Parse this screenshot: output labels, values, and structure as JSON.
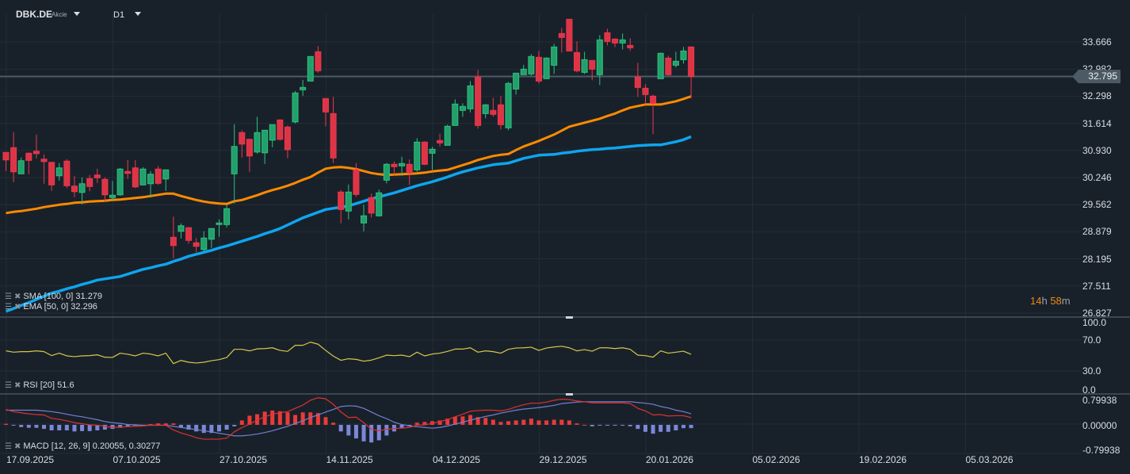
{
  "header": {
    "symbol": "DBK.DE",
    "type": "Akcie",
    "timeframe": "D1"
  },
  "legend": {
    "sma": "SMA [100,  0] 31.279",
    "ema": "EMA [50,  0] 32.296",
    "rsi": "RSI [20]  51.6",
    "macd": "MACD [12, 26, 9] 0.20055,  0.30277"
  },
  "price_axis": [
    "33.666",
    "32.982",
    "32.298",
    "31.614",
    "30.930",
    "30.246",
    "29.562",
    "28.879",
    "28.195",
    "27.511",
    "26.827"
  ],
  "current_price": "32.795",
  "rsi_axis": [
    "100.0",
    "70.0",
    "30.0",
    "0.0"
  ],
  "macd_axis": [
    "0.79938",
    "0.00000",
    "-0.79938"
  ],
  "date_axis": [
    "17.09.2025",
    "07.10.2025",
    "27.10.2025",
    "14.11.2025",
    "04.12.2025",
    "29.12.2025",
    "20.01.2026",
    "05.02.2026",
    "19.02.2026",
    "05.03.2026"
  ],
  "timer": {
    "hours": "14",
    "h": "h",
    "minutes": "58",
    "m": "m"
  },
  "colors": {
    "up": "#22a06b",
    "down": "#dc3545",
    "ema": "#ff8a00",
    "sma": "#0ea5ee",
    "rsi": "#d6c74a",
    "macd": "#e03131",
    "signal": "#7280cf",
    "hist_up": "#ea3a3a",
    "hist_down": "#7b87d9",
    "background": "#18212a"
  },
  "chart_data": {
    "type": "candlestick",
    "ohlc": [
      [
        30.88,
        30.88,
        30.41,
        30.69
      ],
      [
        31.0,
        31.39,
        30.13,
        30.39
      ],
      [
        30.34,
        30.75,
        30.33,
        30.67
      ],
      [
        30.86,
        30.88,
        30.33,
        30.68
      ],
      [
        30.91,
        31.33,
        30.73,
        30.85
      ],
      [
        30.71,
        30.83,
        30.09,
        30.65
      ],
      [
        30.63,
        30.63,
        29.91,
        30.06
      ],
      [
        30.29,
        30.61,
        30.17,
        30.49
      ],
      [
        30.66,
        30.71,
        29.98,
        30.04
      ],
      [
        30.03,
        30.29,
        29.75,
        29.89
      ],
      [
        29.87,
        30.25,
        29.57,
        30.09
      ],
      [
        30.22,
        30.31,
        29.9,
        30.02
      ],
      [
        30.31,
        30.47,
        30.11,
        30.24
      ],
      [
        30.2,
        30.25,
        29.64,
        29.81
      ],
      [
        29.74,
        30.16,
        29.66,
        29.8
      ],
      [
        29.81,
        30.49,
        29.79,
        30.46
      ],
      [
        30.4,
        30.69,
        30.21,
        30.35
      ],
      [
        30.49,
        30.69,
        29.98,
        30.01
      ],
      [
        30.06,
        30.51,
        30.05,
        30.46
      ],
      [
        30.09,
        30.41,
        29.74,
        30.33
      ],
      [
        30.46,
        30.54,
        30.06,
        30.1
      ],
      [
        30.21,
        30.44,
        29.91,
        30.44
      ],
      [
        28.74,
        29.26,
        28.21,
        28.53
      ],
      [
        28.89,
        29.09,
        28.71,
        29.03
      ],
      [
        28.98,
        29.0,
        28.58,
        28.66
      ],
      [
        28.6,
        28.72,
        28.36,
        28.51
      ],
      [
        28.43,
        28.89,
        28.39,
        28.72
      ],
      [
        28.69,
        28.96,
        28.47,
        28.96
      ],
      [
        29.06,
        29.19,
        28.75,
        29.1
      ],
      [
        29.06,
        29.56,
        28.99,
        29.46
      ],
      [
        30.34,
        31.59,
        29.59,
        31.03
      ],
      [
        31.38,
        31.44,
        30.75,
        31.09
      ],
      [
        31.21,
        31.23,
        30.39,
        30.79
      ],
      [
        30.89,
        31.78,
        30.85,
        31.38
      ],
      [
        30.87,
        31.44,
        30.59,
        31.44
      ],
      [
        31.19,
        31.58,
        31.01,
        31.58
      ],
      [
        31.7,
        31.7,
        31.18,
        31.21
      ],
      [
        31.52,
        31.56,
        30.73,
        30.95
      ],
      [
        31.65,
        32.43,
        31.61,
        32.38
      ],
      [
        32.46,
        32.71,
        32.31,
        32.52
      ],
      [
        32.68,
        33.3,
        32.68,
        33.3
      ],
      [
        33.42,
        33.56,
        32.89,
        32.94
      ],
      [
        32.24,
        32.24,
        31.54,
        31.9
      ],
      [
        31.86,
        32.28,
        30.61,
        30.74
      ],
      [
        29.88,
        29.93,
        29.09,
        29.44
      ],
      [
        29.4,
        30.07,
        29.19,
        29.88
      ],
      [
        30.44,
        30.61,
        29.76,
        29.82
      ],
      [
        29.1,
        29.56,
        28.89,
        29.28
      ],
      [
        29.74,
        29.84,
        29.24,
        29.35
      ],
      [
        29.28,
        29.94,
        29.26,
        29.86
      ],
      [
        30.18,
        30.61,
        30.1,
        30.58
      ],
      [
        30.58,
        30.65,
        30.29,
        30.52
      ],
      [
        30.54,
        30.77,
        30.29,
        30.6
      ],
      [
        30.58,
        30.7,
        30.06,
        30.36
      ],
      [
        30.44,
        31.24,
        30.39,
        31.14
      ],
      [
        31.14,
        31.16,
        30.56,
        30.58
      ],
      [
        30.86,
        31.02,
        30.44,
        30.96
      ],
      [
        31.18,
        31.35,
        31.03,
        31.12
      ],
      [
        31.06,
        31.58,
        31.06,
        31.54
      ],
      [
        31.56,
        32.22,
        31.56,
        32.1
      ],
      [
        31.94,
        32.12,
        31.78,
        32.04
      ],
      [
        31.98,
        32.68,
        31.89,
        32.56
      ],
      [
        32.78,
        32.96,
        31.48,
        31.56
      ],
      [
        31.86,
        32.1,
        31.74,
        32.08
      ],
      [
        31.94,
        32.26,
        31.78,
        31.84
      ],
      [
        32.08,
        32.3,
        31.46,
        31.58
      ],
      [
        31.5,
        32.66,
        31.44,
        32.62
      ],
      [
        32.48,
        32.88,
        32.34,
        32.88
      ],
      [
        32.84,
        33.09,
        32.84,
        32.98
      ],
      [
        32.86,
        33.36,
        32.82,
        33.3
      ],
      [
        33.28,
        33.44,
        32.62,
        32.68
      ],
      [
        32.74,
        33.28,
        32.74,
        33.26
      ],
      [
        33.08,
        33.62,
        32.86,
        33.54
      ],
      [
        33.88,
        34.02,
        33.4,
        33.78
      ],
      [
        34.24,
        34.24,
        33.44,
        33.44
      ],
      [
        33.4,
        33.68,
        32.9,
        32.94
      ],
      [
        32.9,
        33.42,
        32.86,
        33.22
      ],
      [
        33.2,
        33.2,
        32.7,
        32.98
      ],
      [
        32.84,
        33.84,
        32.58,
        33.72
      ],
      [
        33.9,
        34.0,
        33.58,
        33.68
      ],
      [
        33.74,
        33.76,
        33.54,
        33.64
      ],
      [
        33.64,
        33.88,
        33.48,
        33.72
      ],
      [
        33.58,
        33.76,
        33.44,
        33.52
      ],
      [
        32.78,
        33.14,
        32.28,
        32.52
      ],
      [
        32.5,
        32.6,
        32.1,
        32.34
      ],
      [
        32.3,
        32.34,
        31.34,
        32.12
      ],
      [
        32.74,
        33.4,
        32.74,
        33.38
      ],
      [
        33.26,
        33.32,
        32.82,
        32.84
      ],
      [
        33.08,
        33.42,
        33.02,
        33.18
      ],
      [
        33.22,
        33.54,
        33.12,
        33.44
      ],
      [
        33.54,
        33.56,
        32.24,
        32.795
      ]
    ],
    "ema50": [
      29.35,
      29.38,
      29.4,
      29.43,
      29.46,
      29.5,
      29.53,
      29.56,
      29.58,
      29.61,
      29.62,
      29.64,
      29.65,
      29.66,
      29.68,
      29.69,
      29.71,
      29.73,
      29.75,
      29.78,
      29.81,
      29.84,
      29.84,
      29.78,
      29.73,
      29.68,
      29.64,
      29.61,
      29.59,
      29.58,
      29.65,
      29.68,
      29.74,
      29.8,
      29.87,
      29.93,
      29.98,
      30.04,
      30.11,
      30.19,
      30.26,
      30.37,
      30.47,
      30.5,
      30.51,
      30.49,
      30.46,
      30.41,
      30.36,
      30.33,
      30.31,
      30.32,
      30.33,
      30.34,
      30.35,
      30.37,
      30.4,
      30.42,
      30.44,
      30.5,
      30.56,
      30.62,
      30.69,
      30.74,
      30.79,
      30.82,
      30.84,
      30.94,
      31.03,
      31.1,
      31.17,
      31.25,
      31.33,
      31.43,
      31.53,
      31.58,
      31.63,
      31.68,
      31.73,
      31.8,
      31.86,
      31.94,
      32.01,
      32.05,
      32.09,
      32.09,
      32.09,
      32.13,
      32.17,
      32.23,
      32.296
    ],
    "sma100": [
      26.87,
      26.94,
      27.02,
      27.09,
      27.17,
      27.25,
      27.33,
      27.38,
      27.44,
      27.49,
      27.55,
      27.6,
      27.66,
      27.69,
      27.72,
      27.75,
      27.81,
      27.87,
      27.93,
      27.97,
      28.02,
      28.06,
      28.13,
      28.19,
      28.26,
      28.31,
      28.36,
      28.41,
      28.47,
      28.52,
      28.58,
      28.64,
      28.7,
      28.76,
      28.83,
      28.89,
      28.96,
      29.05,
      29.14,
      29.23,
      29.3,
      29.37,
      29.44,
      29.47,
      29.5,
      29.53,
      29.59,
      29.65,
      29.71,
      29.76,
      29.81,
      29.86,
      29.92,
      29.98,
      30.04,
      30.09,
      30.14,
      30.2,
      30.26,
      30.33,
      30.39,
      30.44,
      30.49,
      30.53,
      30.57,
      30.59,
      30.61,
      30.67,
      30.73,
      30.77,
      30.81,
      30.82,
      30.83,
      30.86,
      30.88,
      30.91,
      30.93,
      30.95,
      30.96,
      30.98,
      30.99,
      31.01,
      31.03,
      31.05,
      31.06,
      31.07,
      31.07,
      31.11,
      31.15,
      31.2,
      31.279
    ],
    "rsi": [
      56.0,
      54.3,
      55.0,
      55.0,
      56.0,
      55.0,
      49.9,
      53.0,
      49.5,
      48.5,
      49.5,
      49.9,
      50.9,
      47.8,
      47.5,
      53.0,
      51.6,
      49.5,
      53.0,
      51.9,
      49.5,
      53.0,
      39.5,
      43.6,
      41.3,
      40.3,
      41.3,
      43.3,
      44.7,
      47.4,
      58.0,
      58.0,
      56.0,
      58.6,
      59.0,
      60.0,
      56.6,
      55.3,
      63.2,
      63.2,
      67.3,
      64.6,
      56.6,
      49.2,
      43.8,
      45.8,
      45.0,
      42.6,
      44.0,
      47.0,
      50.5,
      49.8,
      50.5,
      48.5,
      54.3,
      49.5,
      51.9,
      53.0,
      55.3,
      58.3,
      58.3,
      60.0,
      54.3,
      56.0,
      55.0,
      53.0,
      58.0,
      59.7,
      60.0,
      60.7,
      56.6,
      59.7,
      61.0,
      62.0,
      60.0,
      56.0,
      57.6,
      55.6,
      60.0,
      60.0,
      59.0,
      60.0,
      58.0,
      50.5,
      49.8,
      47.8,
      56.0,
      53.0,
      54.3,
      55.6,
      51.6
    ],
    "macd": [
      0.42,
      0.36,
      0.33,
      0.3,
      0.28,
      0.27,
      0.18,
      0.15,
      0.11,
      0.06,
      0.03,
      0.0,
      -0.01,
      -0.04,
      -0.07,
      -0.06,
      -0.05,
      -0.04,
      -0.03,
      -0.01,
      -0.01,
      -0.01,
      -0.14,
      -0.22,
      -0.28,
      -0.35,
      -0.39,
      -0.39,
      -0.39,
      -0.36,
      -0.19,
      -0.07,
      0.02,
      0.13,
      0.22,
      0.29,
      0.33,
      0.36,
      0.45,
      0.54,
      0.67,
      0.74,
      0.71,
      0.56,
      0.35,
      0.2,
      0.21,
      0.06,
      -0.12,
      -0.16,
      -0.12,
      -0.1,
      -0.09,
      -0.07,
      -0.01,
      0.0,
      0.04,
      0.09,
      0.14,
      0.22,
      0.29,
      0.37,
      0.39,
      0.4,
      0.4,
      0.38,
      0.42,
      0.49,
      0.55,
      0.59,
      0.59,
      0.62,
      0.67,
      0.7,
      0.69,
      0.65,
      0.63,
      0.6,
      0.6,
      0.6,
      0.6,
      0.6,
      0.58,
      0.45,
      0.38,
      0.27,
      0.28,
      0.24,
      0.25,
      0.25,
      0.2
    ],
    "signal": [
      0.4,
      0.4,
      0.4,
      0.4,
      0.4,
      0.38,
      0.36,
      0.33,
      0.29,
      0.25,
      0.22,
      0.18,
      0.14,
      0.09,
      0.06,
      0.04,
      0.01,
      0.0,
      -0.01,
      -0.01,
      -0.01,
      -0.01,
      -0.04,
      -0.07,
      -0.1,
      -0.13,
      -0.16,
      -0.19,
      -0.23,
      -0.26,
      -0.3,
      -0.3,
      -0.28,
      -0.25,
      -0.21,
      -0.16,
      -0.1,
      -0.04,
      0.04,
      0.11,
      0.2,
      0.27,
      0.35,
      0.42,
      0.5,
      0.52,
      0.51,
      0.45,
      0.35,
      0.25,
      0.17,
      0.07,
      0.01,
      -0.03,
      -0.05,
      -0.07,
      -0.09,
      -0.07,
      -0.03,
      0.02,
      0.07,
      0.13,
      0.18,
      0.23,
      0.27,
      0.32,
      0.36,
      0.4,
      0.43,
      0.45,
      0.47,
      0.5,
      0.53,
      0.58,
      0.6,
      0.62,
      0.63,
      0.63,
      0.63,
      0.63,
      0.63,
      0.63,
      0.63,
      0.61,
      0.59,
      0.56,
      0.5,
      0.46,
      0.4,
      0.36,
      0.3
    ],
    "histogram": [
      0.03,
      -0.02,
      -0.06,
      -0.08,
      -0.08,
      -0.11,
      -0.15,
      -0.15,
      -0.15,
      -0.18,
      -0.17,
      -0.17,
      -0.15,
      -0.13,
      -0.11,
      -0.08,
      -0.04,
      -0.01,
      0,
      0.02,
      0.04,
      0.04,
      0.04,
      -0.08,
      -0.13,
      -0.18,
      -0.22,
      -0.22,
      -0.18,
      -0.13,
      -0.04,
      0.12,
      0.25,
      0.29,
      0.36,
      0.39,
      0.37,
      0.34,
      0.27,
      0.34,
      0.34,
      0.32,
      0.21,
      0.06,
      -0.18,
      -0.29,
      -0.37,
      -0.45,
      -0.48,
      -0.42,
      -0.29,
      -0.18,
      -0.08,
      -0.04,
      0.06,
      0.08,
      0.1,
      0.12,
      0.17,
      0.22,
      0.23,
      0.27,
      0.21,
      0.19,
      0.14,
      0.08,
      0.1,
      0.12,
      0.14,
      0.17,
      0.12,
      0.12,
      0.14,
      0.14,
      0.12,
      0.04,
      0,
      -0.04,
      -0.02,
      -0.02,
      -0.02,
      -0.02,
      -0.04,
      -0.11,
      -0.19,
      -0.24,
      -0.19,
      -0.19,
      -0.15,
      -0.09,
      -0.09
    ],
    "rsi_range": [
      0,
      100
    ],
    "macd_range": [
      -0.79938,
      0.79938
    ],
    "grid": true
  }
}
